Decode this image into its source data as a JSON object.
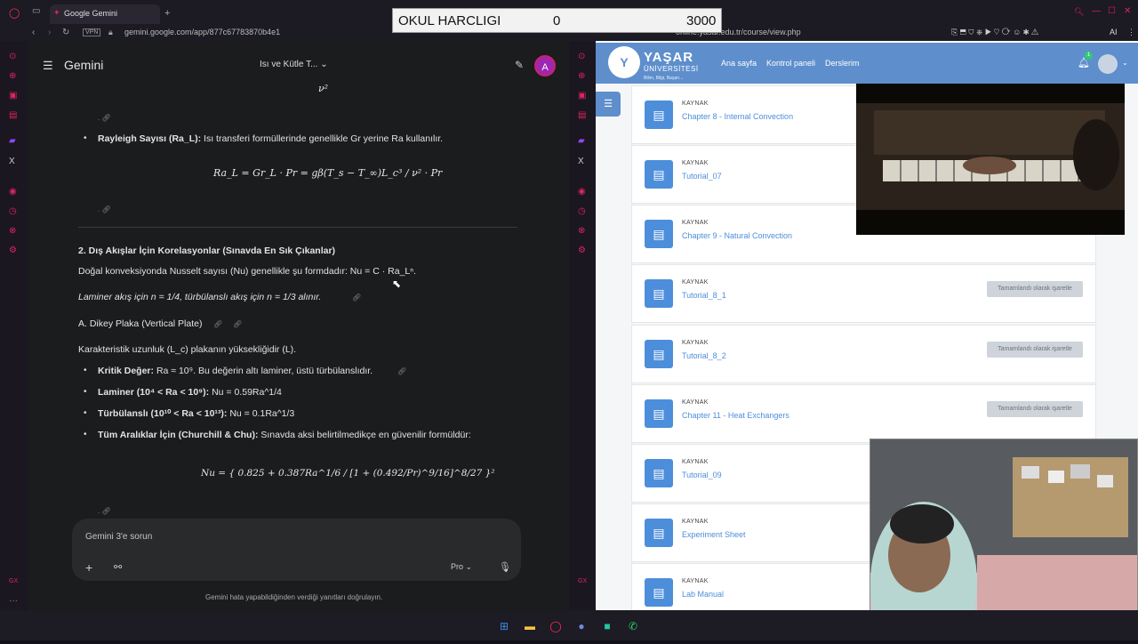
{
  "left_browser": {
    "tab_title": "Google Gemini",
    "url": "gemini.google.com/app/877c67783870b4e1"
  },
  "gemini": {
    "app_name": "Gemini",
    "chat_title": "Isı ve Kütle T...",
    "avatar_letter": "A",
    "content": {
      "top_fraction_denominator": "ν²",
      "rayleigh_label": "Rayleigh Sayısı (Ra_L):",
      "rayleigh_text": "Isı transferi formüllerinde genellikle Gr yerine Ra kullanılır.",
      "rayleigh_formula": "Ra_L = Gr_L · Pr = gβ(T_s − T_∞)L_c³ / ν² · Pr",
      "section2_heading": "2. Dış Akışlar İçin Korelasyonlar (Sınavda En Sık Çıkanlar)",
      "nusselt_text": "Doğal konveksiyonda Nusselt sayısı (Nu) genellikle şu formdadır: Nu = C · Ra_Lⁿ.",
      "laminar_text": "Laminer akış için n = 1/4, türbülanslı akış için n = 1/3 alınır.",
      "subsection_a": "A. Dikey Plaka (Vertical Plate)",
      "char_length": "Karakteristik uzunluk (L_c) plakanın yüksekliğidir (L).",
      "bullets": [
        {
          "label": "Kritik Değer:",
          "text": "Ra ≈ 10⁹. Bu değerin altı laminer, üstü türbülanslıdır."
        },
        {
          "label": "Laminer (10⁴ < Ra < 10⁹):",
          "text": "Nu = 0.59Ra^1/4"
        },
        {
          "label": "Türbülanslı (10¹⁰ < Ra < 10¹³):",
          "text": "Nu = 0.1Ra^1/3"
        },
        {
          "label": "Tüm Aralıklar İçin (Churchill & Chu):",
          "text": "Sınavda aksi belirtilmedikçe en güvenilir formüldür:"
        }
      ],
      "churchill_formula": "Nu = { 0.825 + 0.387Ra^1/6 / [1 + (0.492/Pr)^9/16]^8/27 }²"
    },
    "prompt_placeholder": "Gemini 3'e sorun",
    "model_label": "Pro",
    "footer_note": "Gemini hata yapabildiğinden verdiği yanıtları doğrulayın."
  },
  "right_browser": {
    "url": "online.yasar.edu.tr/course/view.php"
  },
  "moodle": {
    "logo_name": "YAŞAR",
    "logo_sub": "ÜNİVERSİTESİ",
    "logo_slogan": "Bilim, Bilgi, Başarı...",
    "nav": [
      "Ana sayfa",
      "Kontrol paneli",
      "Derslerim"
    ],
    "notification_count": "1",
    "resource_type": "KAYNAK",
    "mark_complete_label": "Tamamlandı olarak işaretle",
    "resources": [
      {
        "title": "Chapter 8 - Internal Convection",
        "mark": false
      },
      {
        "title": "Tutorial_07",
        "mark": false
      },
      {
        "title": "Chapter 9 - Natural Convection",
        "mark": false
      },
      {
        "title": "Tutorial_8_1",
        "mark": true
      },
      {
        "title": "Tutorial_8_2",
        "mark": true
      },
      {
        "title": "Chapter 11 - Heat Exchangers",
        "mark": true
      },
      {
        "title": "Tutorial_09",
        "mark": false
      },
      {
        "title": "Experiment Sheet",
        "mark": false
      },
      {
        "title": "Lab Manual",
        "mark": false
      }
    ]
  },
  "overlay": {
    "label": "OKUL HARCLIGI",
    "current": "0",
    "goal": "3000"
  },
  "colors": {
    "moodle_blue": "#5e8fcc",
    "link_blue": "#4d8edb",
    "gx_red": "#ff2d55"
  }
}
